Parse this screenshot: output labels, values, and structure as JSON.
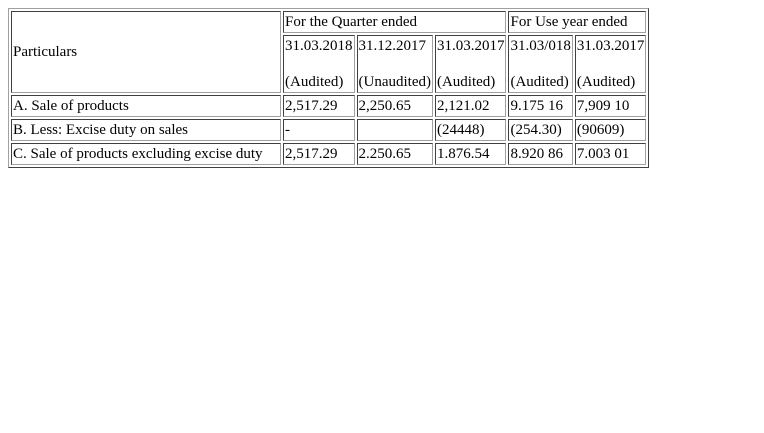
{
  "table": {
    "particulars_label": "Particulars",
    "group_headers": {
      "quarter": "For the Quarter ended",
      "year": "For Use year ended"
    },
    "columns": [
      {
        "date": "31.03.2018",
        "status": "(Audited)"
      },
      {
        "date": "31.12.2017",
        "status": "(Unaudited)"
      },
      {
        "date": "31.03.2017",
        "status": "(Audited)"
      },
      {
        "date": "31.03/018",
        "status": "(Audited)"
      },
      {
        "date": "31.03.2017",
        "status": "(Audited)"
      }
    ],
    "rows": [
      {
        "label": "A. Sale of products",
        "values": [
          "2,517.29",
          "2,250.65",
          "2,121.02",
          "9.175 16",
          "7,909 10"
        ]
      },
      {
        "label": "B. Less: Excise duty on sales",
        "values": [
          "-",
          "",
          "(24448)",
          "(254.30)",
          "(90609)"
        ]
      },
      {
        "label": "C. Sale of products excluding excise duty",
        "values": [
          "2,517.29",
          "2.250.65",
          "1.876.54",
          "8.920 86",
          "7.003 01"
        ]
      }
    ]
  }
}
